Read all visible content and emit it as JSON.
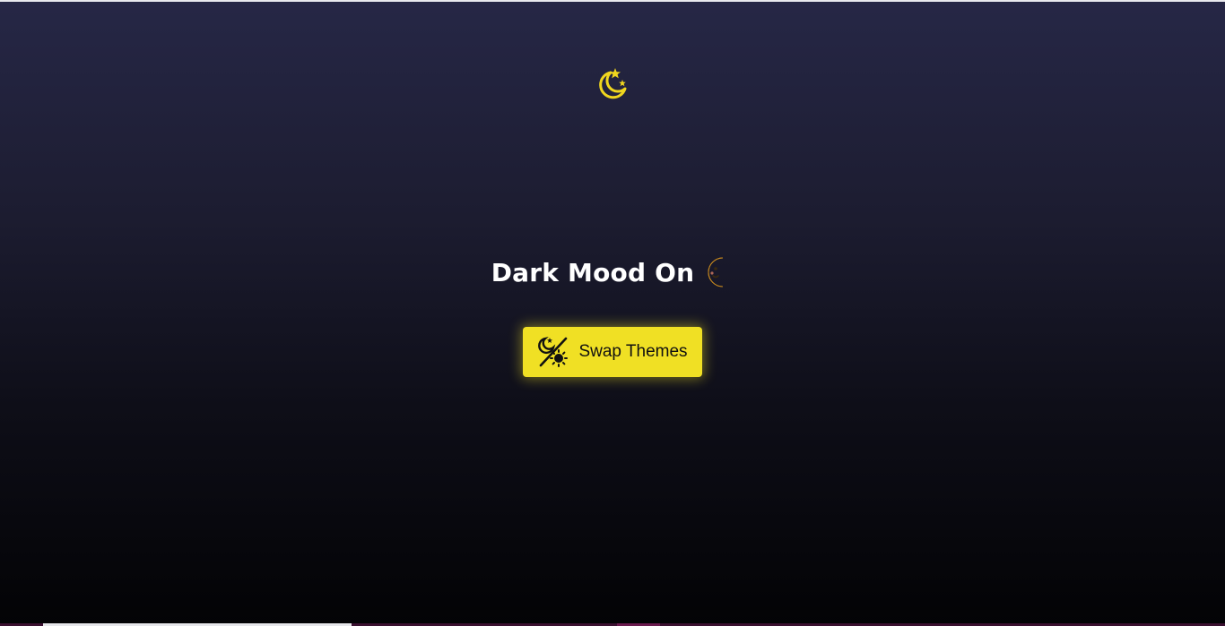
{
  "top_icon": {
    "name": "moon-stars-icon",
    "color": "#f0d61e"
  },
  "headline": {
    "text": "Dark Mood On",
    "emoji": "crescent-moon-face-icon"
  },
  "swap_button": {
    "label": "Swap Themes",
    "icon": "theme-swap-icon",
    "background": "#f0e024"
  },
  "colors": {
    "bg_top": "#262746",
    "bg_bottom": "#030305",
    "text": "#ffffff",
    "accent": "#f0e024"
  }
}
